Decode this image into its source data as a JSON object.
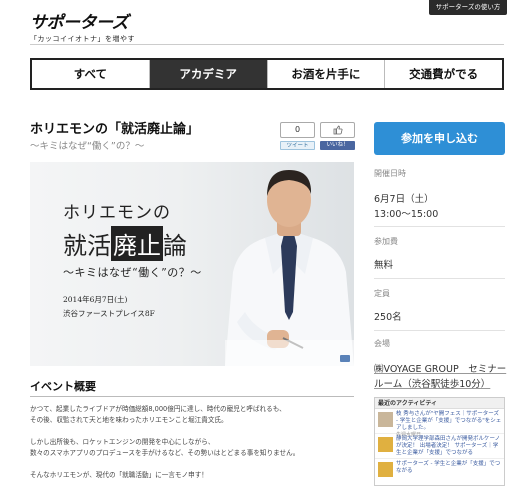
{
  "header": {
    "logo": "サポーターズ",
    "tagline": "「カッコイイオトナ」を増やす",
    "howto": "サポーターズの使い方"
  },
  "nav": {
    "tabs": [
      {
        "label": "すべて"
      },
      {
        "label": "アカデミア"
      },
      {
        "label": "お酒を片手に"
      },
      {
        "label": "交通費がでる"
      }
    ],
    "active_index": 1
  },
  "event": {
    "title": "ホリエモンの「就活廃止論」",
    "subtitle": "〜キミはなぜ“働く”の？〜"
  },
  "social": {
    "tweet_count": "0",
    "tweet_label": "ツイート",
    "like_label": "いいね！"
  },
  "hero": {
    "line1": "ホリエモンの",
    "line2a": "就活",
    "line2b": "廃止",
    "line2c": "論",
    "line3": "〜キミはなぜ“働く”の？〜",
    "date": "2014年6月7日(土)",
    "place": "渋谷ファーストプレイス8F"
  },
  "overview": {
    "title": "イベント概要",
    "lines": [
      "かつて、起業したライブドアが時価総額8,000億円に達し、時代の寵児と呼ばれるも、",
      "その後、収監されて天と地を味わったホリエモンこと堀江貴文氏。",
      "",
      "しかし出所後も、ロケットエンジンの開発を中心にしながら、",
      "数々のスマホアプリのプロデュースを手がけるなど、その勢いはとどまる事を知りません。",
      "",
      "そんなホリエモンが、現代の「就職活動」に一言モノ申す！"
    ]
  },
  "sidebar": {
    "apply": "参加を申し込む",
    "date_label": "開催日時",
    "date_value": "6月7日（土）",
    "time_value": "13:00〜15:00",
    "fee_label": "参加費",
    "fee_value": "無料",
    "capacity_label": "定員",
    "capacity_value": "250名",
    "venue_label": "会場",
    "venue_value": "㈱VOYAGE GROUP　セミナールーム（渋谷駅徒歩10分）"
  },
  "activity": {
    "title": "最近のアクティビティ",
    "items": [
      {
        "text": "枝 秀与さんが\"ヤ開フェス｜サポーターズ - 学生と企業が「支援」でつながる\"をシェアしました。",
        "time": "先週水曜日"
      },
      {
        "text": "静岡大学理学部森田さんが開発ボルケーノが決定！ 出場者決定！ サポーターズ｜学生と企業が「支援」でつながる",
        "time": ""
      },
      {
        "text": "サポーターズ - 学生と企業が「支援」でつながる",
        "time": ""
      }
    ]
  }
}
